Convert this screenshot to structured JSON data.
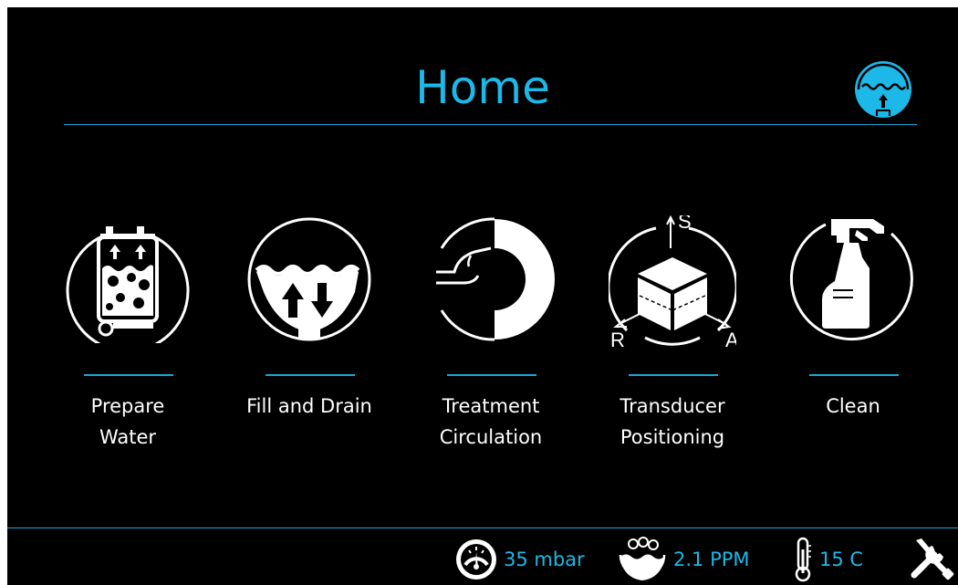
{
  "header": {
    "title": "Home",
    "water_icon": "water-level-icon"
  },
  "tiles": [
    {
      "label": "Prepare\nWater",
      "icon": "prepare-water-icon"
    },
    {
      "label": "Fill and Drain",
      "icon": "fill-drain-icon"
    },
    {
      "label": "Treatment\nCirculation",
      "icon": "treatment-circulation-icon"
    },
    {
      "label": "Transducer\nPositioning",
      "icon": "transducer-positioning-icon",
      "axis_labels": {
        "s": "S",
        "r": "R",
        "a": "A"
      }
    },
    {
      "label": "Clean",
      "icon": "clean-spray-icon"
    }
  ],
  "status": {
    "pressure": "35 mbar",
    "gas": "2.1 PPM",
    "temperature": "15 C"
  },
  "colors": {
    "accent": "#1cb8e8",
    "background": "#000000",
    "text": "#ffffff"
  }
}
